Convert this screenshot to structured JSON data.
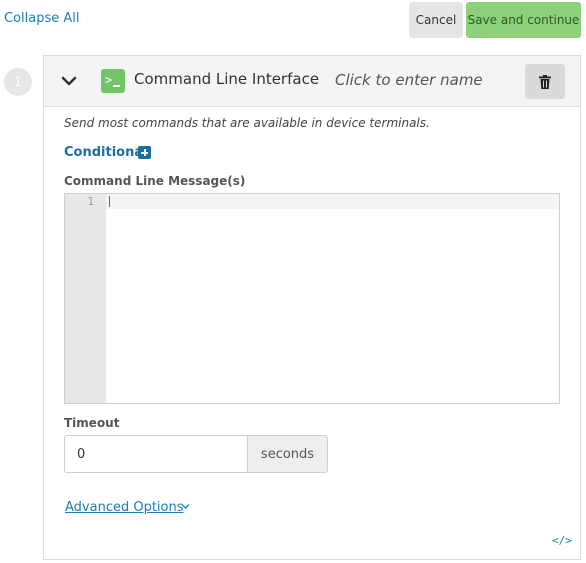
{
  "toolbar": {
    "collapse_all": "Collapse All",
    "cancel": "Cancel",
    "save_and_continue": "Save and continue"
  },
  "step": {
    "number": "1",
    "title": "Command Line Interface",
    "name_placeholder": "Click to enter name",
    "description": "Send most commands that are available in device terminals.",
    "conditional_label": "Conditional",
    "message_label": "Command Line Message(s)",
    "editor": {
      "line_number": "1",
      "content": ""
    },
    "timeout_label": "Timeout",
    "timeout_value": "0",
    "timeout_unit": "seconds",
    "advanced_options": "Advanced Options",
    "code_toggle": "</>"
  },
  "icons": {
    "cli": "terminal-icon",
    "collapse": "chevron-down-icon",
    "delete": "trash-icon",
    "add": "plus-square-icon",
    "advanced": "chevron-down-icon",
    "code": "code-icon"
  },
  "colors": {
    "link": "#1a7fb5",
    "save_button": "#8dd07a",
    "cli_icon": "#71c566",
    "conditional": "#1a6ea0"
  }
}
